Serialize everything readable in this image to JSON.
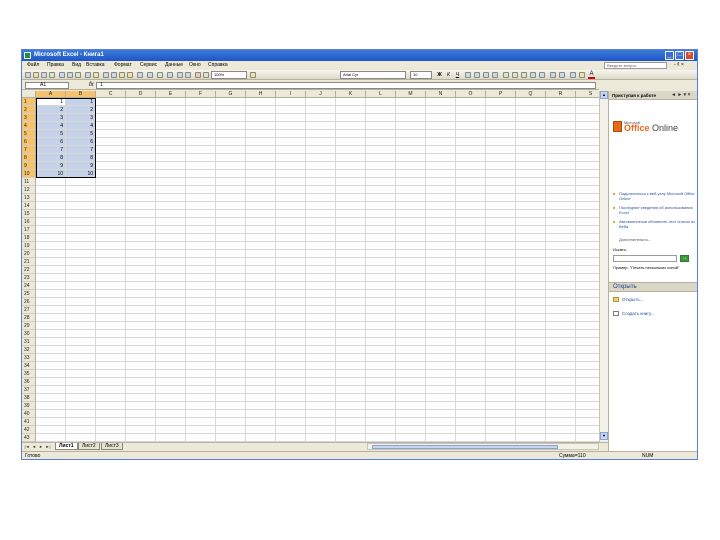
{
  "window": {
    "title": "Microsoft Excel - Книга1",
    "controls": {
      "minimize": "_",
      "maximize": "□",
      "close": "×"
    }
  },
  "menu": {
    "items": [
      "Файл",
      "Правка",
      "Вид",
      "Вставка",
      "Формат",
      "Сервис",
      "Данные",
      "Окно",
      "Справка"
    ],
    "help_placeholder": "Введите вопрос",
    "close_glyph": "- ₫ ×"
  },
  "toolbar": {
    "zoom": "100%",
    "font": "Arial Cyr",
    "font_size": "10",
    "bold": "Ж",
    "italic": "К",
    "underline": "Ч",
    "font_color": "A"
  },
  "formula_bar": {
    "name_box": "A1",
    "fx": "fx",
    "value": "1"
  },
  "sheet": {
    "columns": [
      "A",
      "B",
      "C",
      "D",
      "E",
      "F",
      "G",
      "H",
      "I",
      "J",
      "K",
      "L",
      "M",
      "N",
      "O",
      "P",
      "Q",
      "R",
      "S"
    ],
    "rows": [
      "1",
      "2",
      "3",
      "4",
      "5",
      "6",
      "7",
      "8",
      "9",
      "10",
      "11",
      "12",
      "13",
      "14",
      "15",
      "16",
      "17",
      "18",
      "19",
      "20",
      "21",
      "22",
      "23",
      "24",
      "25",
      "26",
      "27",
      "28",
      "29",
      "30",
      "31",
      "32",
      "33",
      "34",
      "35",
      "36",
      "37",
      "38",
      "39",
      "40",
      "41",
      "42",
      "43"
    ],
    "colA": [
      "1",
      "2",
      "3",
      "4",
      "5",
      "6",
      "7",
      "8",
      "9",
      "10"
    ],
    "colB": [
      "1",
      "2",
      "3",
      "4",
      "5",
      "6",
      "7",
      "8",
      "9",
      "10"
    ],
    "selected_columns": [
      "A",
      "B"
    ],
    "selected_rows": 10
  },
  "tabs": {
    "nav": [
      "|◄",
      "◄",
      "►",
      "►|"
    ],
    "sheets": [
      "Лист1",
      "Лист2",
      "Лист3"
    ],
    "active": 0
  },
  "status": {
    "left": "Готово",
    "sum": "Сумма=110",
    "num": "NUM"
  },
  "task_pane": {
    "title": "Приступая к работе",
    "header_controls": "◄ ► ▾ ×",
    "logo_small": "Microsoft",
    "logo_office": "Office",
    "logo_online": " Online",
    "bullets": [
      "Подключиться к веб-узлу Microsoft Office Online",
      "Последние сведения об использовании Excel",
      "Автоматически обновлять этот список из Веба"
    ],
    "more": "Дополнительно...",
    "search_label": "Искать:",
    "go": "→",
    "example": "Пример: \"Печать нескольких копий\"",
    "open_section": "Открыть",
    "open_link": "Открыть...",
    "create_link": "Создать книгу..."
  }
}
